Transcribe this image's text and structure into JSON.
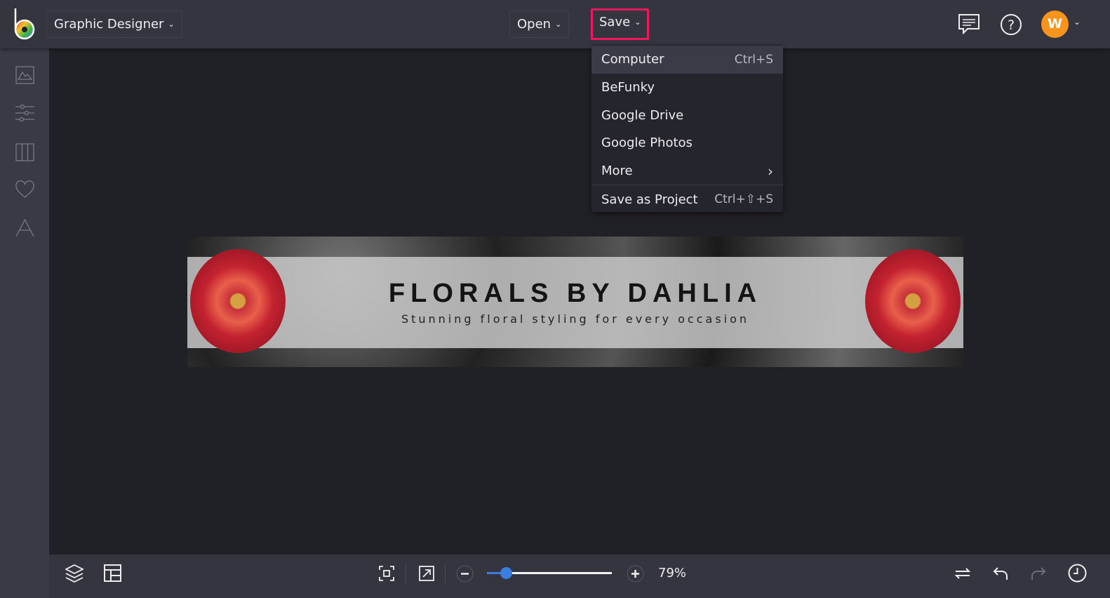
{
  "app": {
    "title": "Graphic Designer",
    "brand_color": "#f0185a"
  },
  "toolbar": {
    "open_label": "Open",
    "save_label": "Save",
    "user_initial": "W",
    "icons": [
      "chat-icon",
      "help-icon",
      "avatar"
    ]
  },
  "sidebar": {
    "items": [
      {
        "icon": "image-icon"
      },
      {
        "icon": "sliders-icon"
      },
      {
        "icon": "layout-columns-icon"
      },
      {
        "icon": "heart-icon"
      },
      {
        "icon": "text-icon"
      }
    ]
  },
  "save_menu": {
    "items": [
      {
        "label": "Computer",
        "shortcut": "Ctrl+S",
        "highlighted": true
      },
      {
        "label": "BeFunky",
        "shortcut": ""
      },
      {
        "label": "Google Drive",
        "shortcut": ""
      },
      {
        "label": "Google Photos",
        "shortcut": ""
      },
      {
        "label": "More",
        "shortcut": "›"
      },
      {
        "label": "Save as Project",
        "shortcut": "Ctrl+⇧+S"
      }
    ]
  },
  "canvas": {
    "title": "FLORALS BY DAHLIA",
    "subtitle": "Stunning floral styling for every occasion"
  },
  "bottombar": {
    "zoom_label": "79%",
    "zoom_percent": 79,
    "slider_fraction": 0.15,
    "accent": "#3a7fdc"
  }
}
